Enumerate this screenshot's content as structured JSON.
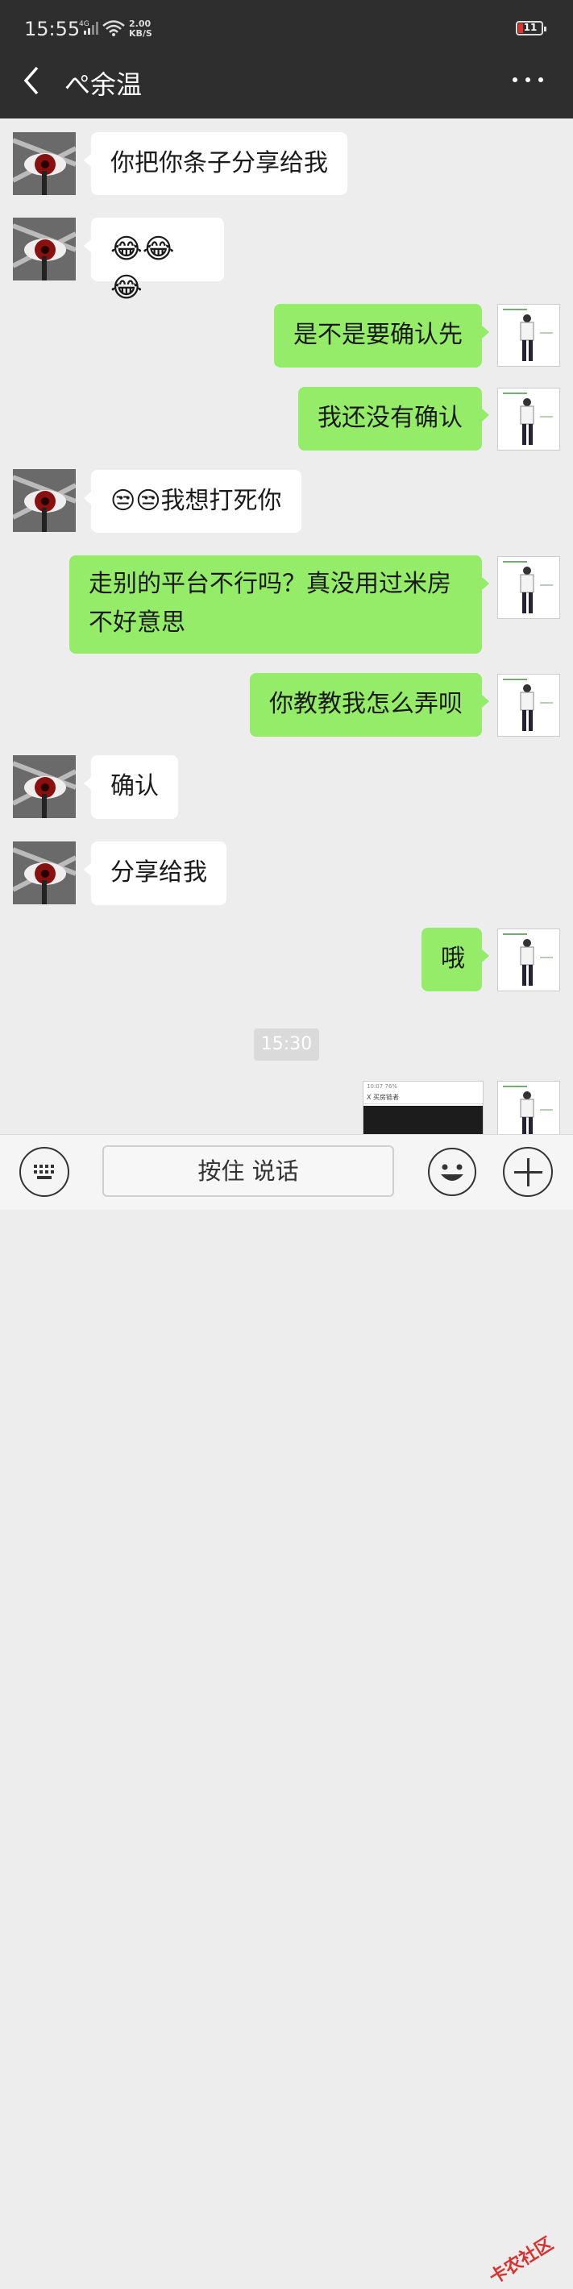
{
  "status_bar": {
    "time": "15:55",
    "network": "4G",
    "speed_value": "2.00",
    "speed_unit": "KB/S",
    "battery": "11"
  },
  "header": {
    "title": "ぺ余温"
  },
  "messages": [
    {
      "side": "in",
      "text": "你把你条子分享给我"
    },
    {
      "side": "in",
      "text": "😂😂😂"
    },
    {
      "side": "out",
      "text": "是不是要确认先"
    },
    {
      "side": "out",
      "text": "我还没有确认"
    },
    {
      "side": "in",
      "text": "😒😒我想打死你"
    },
    {
      "side": "out",
      "line1": "走别的平台不行吗？真没用过米房",
      "line2": "不好意思"
    },
    {
      "side": "out",
      "text": "你教教我怎么弄呗"
    },
    {
      "side": "in",
      "text": "确认"
    },
    {
      "side": "in",
      "text": "分享给我"
    },
    {
      "side": "out",
      "text": "哦"
    }
  ],
  "timestamp": "15:30",
  "shared_image": {
    "status_line": "10:07 76%",
    "title_line": "X  买房链者"
  },
  "input_bar": {
    "hold_to_talk": "按住 说话"
  },
  "watermark": "卡农社区",
  "colors": {
    "header_bg": "#2e2e2e",
    "chat_bg": "#ededed",
    "outgoing_bubble": "#95ec69",
    "incoming_bubble": "#ffffff"
  }
}
